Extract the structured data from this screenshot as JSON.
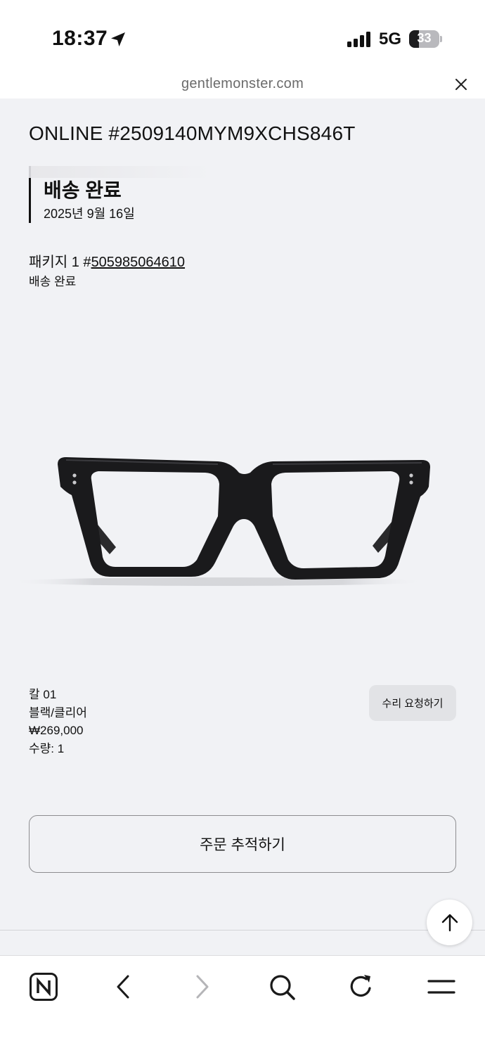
{
  "status_bar": {
    "time": "18:37",
    "network": "5G",
    "battery_level": 33,
    "battery_text": "33"
  },
  "browser": {
    "url": "gentlemonster.com"
  },
  "order": {
    "number": "ONLINE #2509140MYM9XCHS846T",
    "status_title": "배송 완료",
    "status_date": "2025년 9월 16일"
  },
  "package": {
    "prefix": "패키지 1 #",
    "tracking_number": "505985064610",
    "status": "배송 완료"
  },
  "product": {
    "name": "칼 01",
    "color": "블랙/클리어",
    "price": "₩269,000",
    "quantity": "수량: 1",
    "repair_label": "수리 요청하기"
  },
  "actions": {
    "track_order_label": "주문 추적하기"
  },
  "toolbar": {
    "items": [
      "naver-home-icon",
      "back-arrow-icon",
      "forward-arrow-icon",
      "search-icon",
      "refresh-icon",
      "menu-icon"
    ]
  }
}
